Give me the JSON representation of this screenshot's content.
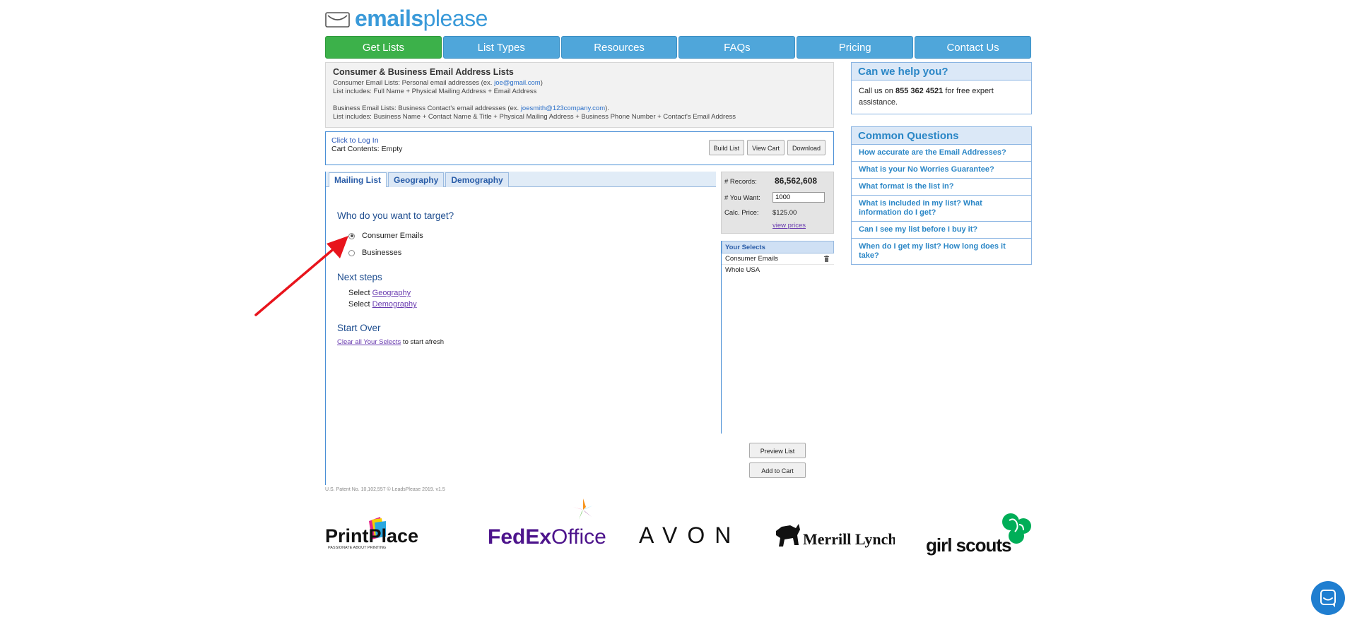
{
  "logo": {
    "part1": "emails",
    "part2": "please"
  },
  "nav": [
    {
      "label": "Get Lists"
    },
    {
      "label": "List Types"
    },
    {
      "label": "Resources"
    },
    {
      "label": "FAQs"
    },
    {
      "label": "Pricing"
    },
    {
      "label": "Contact Us"
    }
  ],
  "info": {
    "title": "Consumer & Business Email Address Lists",
    "consumer_line_prefix": "Consumer Email Lists: Personal email addresses (ex. ",
    "consumer_example": "joe@gmail.com",
    "consumer_line_suffix": ")",
    "consumer_includes": "List includes: Full Name + Physical Mailing Address + Email Address",
    "business_line_prefix": "Business Email Lists: Business Contact's email addresses (ex. ",
    "business_example": "joesmith@123company.com",
    "business_line_suffix": ").",
    "business_includes": "List includes: Business Name + Contact Name & Title + Physical Mailing Address + Business Phone Number + Contact's Email Address"
  },
  "login": {
    "login_link": "Click to Log In",
    "cart_contents": "Cart Contents: Empty",
    "build_list": "Build List",
    "view_cart": "View Cart",
    "download": "Download"
  },
  "tabs": [
    {
      "label": "Mailing List"
    },
    {
      "label": "Geography"
    },
    {
      "label": "Demography"
    }
  ],
  "target": {
    "question": "Who do you want to target?",
    "options": [
      {
        "label": "Consumer Emails",
        "checked": true
      },
      {
        "label": "Businesses",
        "checked": false
      }
    ]
  },
  "next_steps": {
    "heading": "Next steps",
    "step1_prefix": "Select ",
    "step1_link": "Geography",
    "step2_prefix": "Select ",
    "step2_link": "Demography"
  },
  "start_over": {
    "heading": "Start Over",
    "link": "Clear all Your Selects",
    "suffix": " to start afresh"
  },
  "records": {
    "records_label": "# Records:",
    "records_value": "86,562,608",
    "want_label": "# You Want:",
    "want_value": "1000",
    "price_label": "Calc. Price:",
    "price_value": "$125.00",
    "view_prices": "view prices"
  },
  "selects": {
    "heading": "Your Selects",
    "items": [
      "Consumer Emails",
      "Whole USA"
    ]
  },
  "actions": {
    "preview": "Preview List",
    "add_cart": "Add to Cart"
  },
  "footer": "U.S. Patent No. 10,102,557 © LeadsPlease 2019. v1.5",
  "help": {
    "heading": "Can we help you?",
    "text_prefix": "Call us on ",
    "phone": "855 362 4521",
    "text_suffix": " for free expert assistance."
  },
  "faq": {
    "heading": "Common Questions",
    "items": [
      "How accurate are the Email Addresses?",
      "What is your No Worries Guarantee?",
      "What format is the list in?",
      "What is included in my list? What information do I get?",
      "Can I see my list before I buy it?",
      "When do I get my list? How long does it take?"
    ]
  },
  "brands": {
    "printplace": "PrintPlace",
    "printplace_tag": "PASSIONATE ABOUT PRINTING",
    "fedex1": "FedEx",
    "fedex2": "Office",
    "avon": "AVON",
    "merrill": "Merrill Lynch",
    "girlscouts": "girl scouts"
  },
  "colors": {
    "nav": "#4fa6da",
    "nav_active": "#3cb14a",
    "accent": "#2a86c6",
    "arrow": "#e8141c"
  }
}
